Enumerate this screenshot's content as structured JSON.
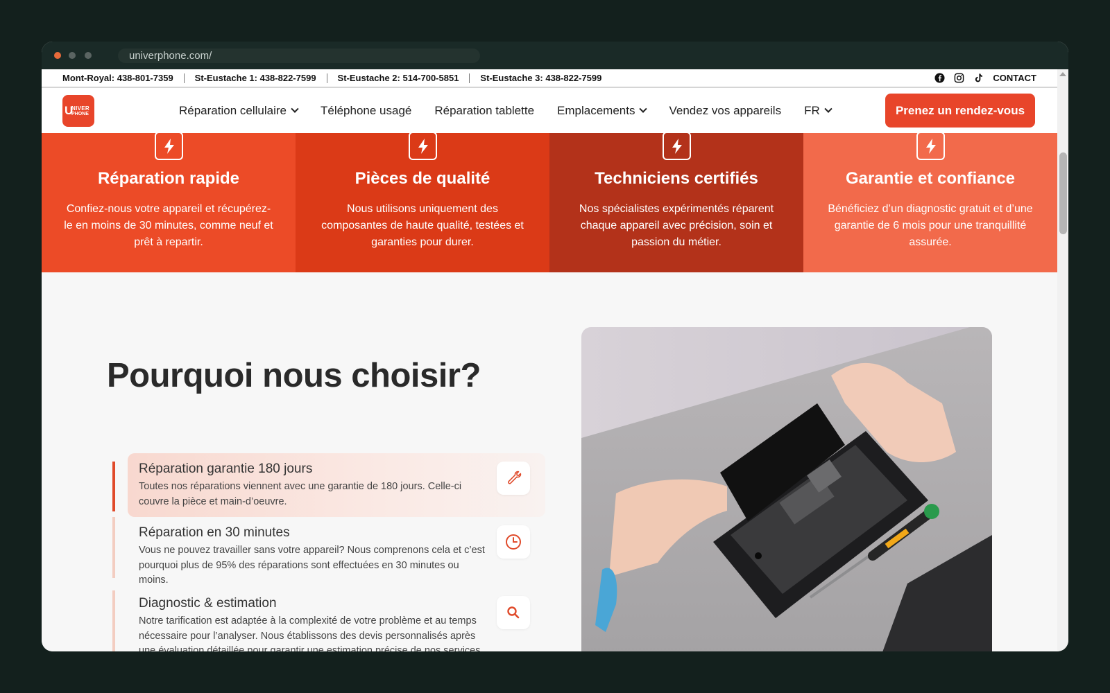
{
  "browser": {
    "url": "univerphone.com/"
  },
  "topbar": {
    "phones": [
      "Mont-Royal: 438-801-7359",
      "St-Eustache 1: 438-822-7599",
      "St-Eustache 2: 514-700-5851",
      "St-Eustache 3: 438-822-7599"
    ],
    "social_icons": [
      "facebook-icon",
      "instagram-icon",
      "tiktok-icon"
    ],
    "contact_label": "CONTACT"
  },
  "nav": {
    "logo_text_1": "NIVER",
    "logo_text_2": "PHONE",
    "logo_letter": "U",
    "items": [
      {
        "label": "Réparation cellulaire",
        "dropdown": true
      },
      {
        "label": "Téléphone usagé",
        "dropdown": false
      },
      {
        "label": "Réparation tablette",
        "dropdown": false
      },
      {
        "label": "Emplacements",
        "dropdown": true
      },
      {
        "label": "Vendez vos appareils",
        "dropdown": false
      },
      {
        "label": "FR",
        "dropdown": true
      }
    ],
    "cta_label": "Prenez un rendez-vous"
  },
  "features": [
    {
      "icon": "lightning-icon",
      "title": "Réparation rapide",
      "text": "Confiez-nous votre appareil et récupérez-le en moins de 30 minutes, comme neuf et prêt à repartir.",
      "color": "#ec4b27"
    },
    {
      "icon": "lightning-icon",
      "title": "Pièces de qualité",
      "text": "Nous utilisons uniquement des composantes de haute qualité, testées et garanties pour durer.",
      "color": "#db3a17"
    },
    {
      "icon": "lightning-icon",
      "title": "Techniciens certifiés",
      "text": "Nos spécialistes expérimentés réparent chaque appareil avec précision, soin et passion du métier.",
      "color": "#b3321a"
    },
    {
      "icon": "lightning-icon",
      "title": "Garantie et confiance",
      "text": "Bénéficiez d’un diagnostic gratuit et d’une garantie de 6 mois pour une tranquillité assurée.",
      "color": "#f26a4b"
    }
  ],
  "why": {
    "title": "Pourquoi nous choisir?",
    "reasons": [
      {
        "icon": "wrench-icon",
        "title": "Réparation garantie 180 jours",
        "text": "Toutes nos réparations viennent avec une garantie de 180 jours. Celle-ci couvre la pièce et main-d’oeuvre.",
        "active": true
      },
      {
        "icon": "clock-icon",
        "title": "Réparation en 30 minutes",
        "text": "Vous ne pouvez travailler sans votre appareil? Nous comprenons cela et c’est pourquoi plus de 95% des réparations sont effectuées en 30 minutes ou moins.",
        "active": false
      },
      {
        "icon": "search-icon",
        "title": "Diagnostic & estimation",
        "text": "Notre tarification est adaptée à la complexité de votre problème et au temps nécessaire pour l’analyser. Nous établissons des devis personnalisés après une évaluation détaillée pour garantir une estimation précise de nos services de diagnostic.",
        "active": false
      }
    ]
  },
  "colors": {
    "brand": "#e8452a",
    "dark_bg": "#13201d"
  }
}
